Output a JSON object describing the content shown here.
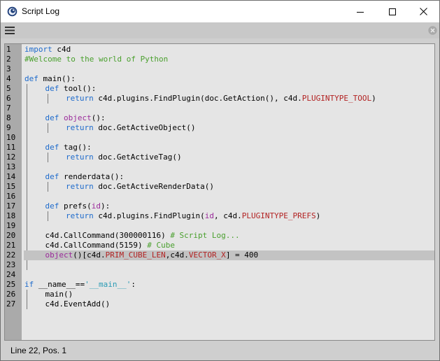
{
  "window": {
    "title": "Script Log",
    "icon": "cinema4d-logo-icon"
  },
  "toolbar": {
    "menu_icon": "hamburger-menu-icon",
    "close_icon": "close-panel-icon"
  },
  "colors": {
    "keyword": "#1e6bcc",
    "comment": "#4aa02e",
    "constant": "#b22222",
    "builtin": "#9b2b9b",
    "string": "#2a9bb5",
    "current_line": "#c3c3c3",
    "gutter": "#aaaaaa",
    "editor_bg": "#e5e5e5"
  },
  "editor": {
    "current_line": 22,
    "lines": [
      {
        "n": "1",
        "indent": 0,
        "tokens": [
          [
            "kw",
            "import"
          ],
          [
            "plain",
            " c4d"
          ]
        ]
      },
      {
        "n": "2",
        "indent": 0,
        "tokens": [
          [
            "comment",
            "#Welcome to the world of Python"
          ]
        ]
      },
      {
        "n": "3",
        "indent": 0,
        "tokens": []
      },
      {
        "n": "4",
        "indent": 0,
        "tokens": [
          [
            "kw",
            "def"
          ],
          [
            "plain",
            " main():"
          ]
        ]
      },
      {
        "n": "5",
        "indent": 1,
        "tokens": [
          [
            "kw",
            "def"
          ],
          [
            "plain",
            " tool():"
          ]
        ]
      },
      {
        "n": "6",
        "indent": 2,
        "tokens": [
          [
            "kw",
            "return"
          ],
          [
            "plain",
            " c4d.plugins.FindPlugin(doc.GetAction(), c4d."
          ],
          [
            "const",
            "PLUGINTYPE_TOOL"
          ],
          [
            "plain",
            ")"
          ]
        ]
      },
      {
        "n": "7",
        "indent": 1,
        "tokens": []
      },
      {
        "n": "8",
        "indent": 1,
        "tokens": [
          [
            "kw",
            "def"
          ],
          [
            "plain",
            " "
          ],
          [
            "builtin",
            "object"
          ],
          [
            "plain",
            "():"
          ]
        ]
      },
      {
        "n": "9",
        "indent": 2,
        "tokens": [
          [
            "kw",
            "return"
          ],
          [
            "plain",
            " doc.GetActiveObject()"
          ]
        ]
      },
      {
        "n": "10",
        "indent": 1,
        "tokens": []
      },
      {
        "n": "11",
        "indent": 1,
        "tokens": [
          [
            "kw",
            "def"
          ],
          [
            "plain",
            " tag():"
          ]
        ]
      },
      {
        "n": "12",
        "indent": 2,
        "tokens": [
          [
            "kw",
            "return"
          ],
          [
            "plain",
            " doc.GetActiveTag()"
          ]
        ]
      },
      {
        "n": "13",
        "indent": 1,
        "tokens": []
      },
      {
        "n": "14",
        "indent": 1,
        "tokens": [
          [
            "kw",
            "def"
          ],
          [
            "plain",
            " renderdata():"
          ]
        ]
      },
      {
        "n": "15",
        "indent": 2,
        "tokens": [
          [
            "kw",
            "return"
          ],
          [
            "plain",
            " doc.GetActiveRenderData()"
          ]
        ]
      },
      {
        "n": "16",
        "indent": 1,
        "tokens": []
      },
      {
        "n": "17",
        "indent": 1,
        "tokens": [
          [
            "kw",
            "def"
          ],
          [
            "plain",
            " prefs("
          ],
          [
            "builtin",
            "id"
          ],
          [
            "plain",
            "):"
          ]
        ]
      },
      {
        "n": "18",
        "indent": 2,
        "tokens": [
          [
            "kw",
            "return"
          ],
          [
            "plain",
            " c4d.plugins.FindPlugin("
          ],
          [
            "builtin",
            "id"
          ],
          [
            "plain",
            ", c4d."
          ],
          [
            "const",
            "PLUGINTYPE_PREFS"
          ],
          [
            "plain",
            ")"
          ]
        ]
      },
      {
        "n": "19",
        "indent": 1,
        "tokens": []
      },
      {
        "n": "20",
        "indent": 1,
        "tokens": [
          [
            "plain",
            "c4d.CallCommand(300000116) "
          ],
          [
            "comment",
            "# Script Log..."
          ]
        ]
      },
      {
        "n": "21",
        "indent": 1,
        "tokens": [
          [
            "plain",
            "c4d.CallCommand(5159) "
          ],
          [
            "comment",
            "# Cube"
          ]
        ]
      },
      {
        "n": "22",
        "indent": 1,
        "tokens": [
          [
            "builtin",
            "object"
          ],
          [
            "plain",
            "()[c4d."
          ],
          [
            "const",
            "PRIM_CUBE_LEN"
          ],
          [
            "plain",
            ",c4d."
          ],
          [
            "const",
            "VECTOR_X"
          ],
          [
            "plain",
            "] = 400"
          ]
        ]
      },
      {
        "n": "23",
        "indent": 1,
        "tokens": []
      },
      {
        "n": "24",
        "indent": 0,
        "tokens": []
      },
      {
        "n": "25",
        "indent": 0,
        "tokens": [
          [
            "kw",
            "if"
          ],
          [
            "plain",
            " __name__=="
          ],
          [
            "str",
            "'__main__'"
          ],
          [
            "plain",
            ":"
          ]
        ]
      },
      {
        "n": "26",
        "indent": 1,
        "tokens": [
          [
            "plain",
            "main()"
          ]
        ]
      },
      {
        "n": "27",
        "indent": 1,
        "tokens": [
          [
            "plain",
            "c4d.EventAdd()"
          ]
        ]
      }
    ]
  },
  "status": {
    "text": "Line 22, Pos. 1"
  }
}
